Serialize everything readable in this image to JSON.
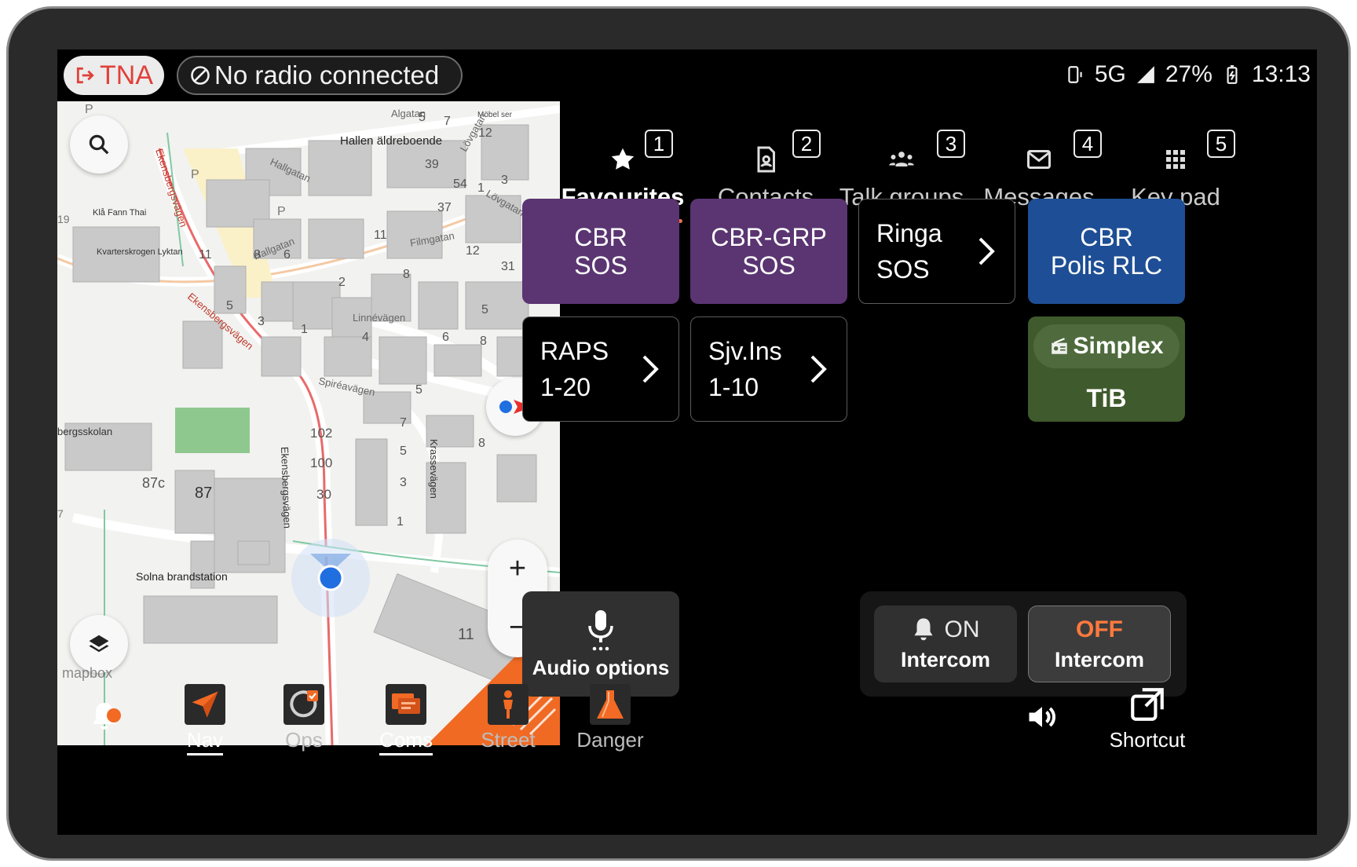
{
  "status_bar": {
    "tna_label": "TNA",
    "radio_status": "No radio connected",
    "network": "5G",
    "battery": "27%",
    "time": "13:13"
  },
  "map": {
    "street_labels": [
      "Algatan",
      "Hallgatan",
      "Lövgatan",
      "Filmgatan",
      "Linnévägen",
      "Spiréavägen",
      "Ekensbergsvägen",
      "Krassevägen"
    ],
    "place_labels": [
      "Hallen äldreboende",
      "Klå Fann Thai",
      "Kvarterskrogen Lyktan",
      "Solna brandstation",
      "bergsskolan",
      "Möbel ser"
    ],
    "house_numbers": [
      "5",
      "7",
      "12",
      "39",
      "54",
      "1",
      "3",
      "37",
      "11",
      "12",
      "31",
      "8",
      "6",
      "2",
      "5",
      "1",
      "3",
      "4",
      "6",
      "8",
      "5",
      "102",
      "100",
      "30",
      "7",
      "5",
      "3",
      "1",
      "87c",
      "87",
      "8",
      "11",
      "P",
      "P",
      "P",
      "19"
    ],
    "attribution": "mapbox"
  },
  "tabs": [
    {
      "label": "Favourites",
      "shortcut": "1",
      "icon": "star-icon",
      "active": true
    },
    {
      "label": "Contacts",
      "shortcut": "2",
      "icon": "contact-card-icon",
      "active": false
    },
    {
      "label": "Talk groups",
      "shortcut": "3",
      "icon": "group-icon",
      "active": false
    },
    {
      "label": "Messages",
      "shortcut": "4",
      "icon": "mail-icon",
      "active": false
    },
    {
      "label": "Key pad",
      "shortcut": "5",
      "icon": "keypad-icon",
      "active": false
    }
  ],
  "favourites": {
    "cbr_sos": {
      "line1": "CBR",
      "line2": "SOS"
    },
    "cbr_grp_sos": {
      "line1": "CBR-GRP",
      "line2": "SOS"
    },
    "ringa_sos": {
      "line1": "Ringa",
      "line2": "SOS"
    },
    "cbr_polis": {
      "line1": "CBR",
      "line2": "Polis RLC"
    },
    "raps": {
      "line1": "RAPS",
      "line2": "1-20"
    },
    "sjv_ins": {
      "line1": "Sjv.Ins",
      "line2": "1-10"
    },
    "simplex": {
      "pill": "Simplex",
      "label": "TiB"
    }
  },
  "audio_options": {
    "label": "Audio options"
  },
  "intercom": {
    "on": {
      "state": "ON",
      "label": "Intercom"
    },
    "off": {
      "state": "OFF",
      "label": "Intercom"
    }
  },
  "bottom_nav": [
    {
      "label": "Nav",
      "active": true
    },
    {
      "label": "Ops",
      "active": false
    },
    {
      "label": "Coms",
      "active": true
    },
    {
      "label": "Street",
      "active": false
    },
    {
      "label": "Danger",
      "active": false
    }
  ],
  "shortcut": {
    "label": "Shortcut"
  },
  "colors": {
    "accent_orange": "#e8704a",
    "tile_purple": "#5a3571",
    "tile_blue": "#1e4e95",
    "tile_green": "#3f5a2c",
    "tna_red": "#e0413a"
  }
}
